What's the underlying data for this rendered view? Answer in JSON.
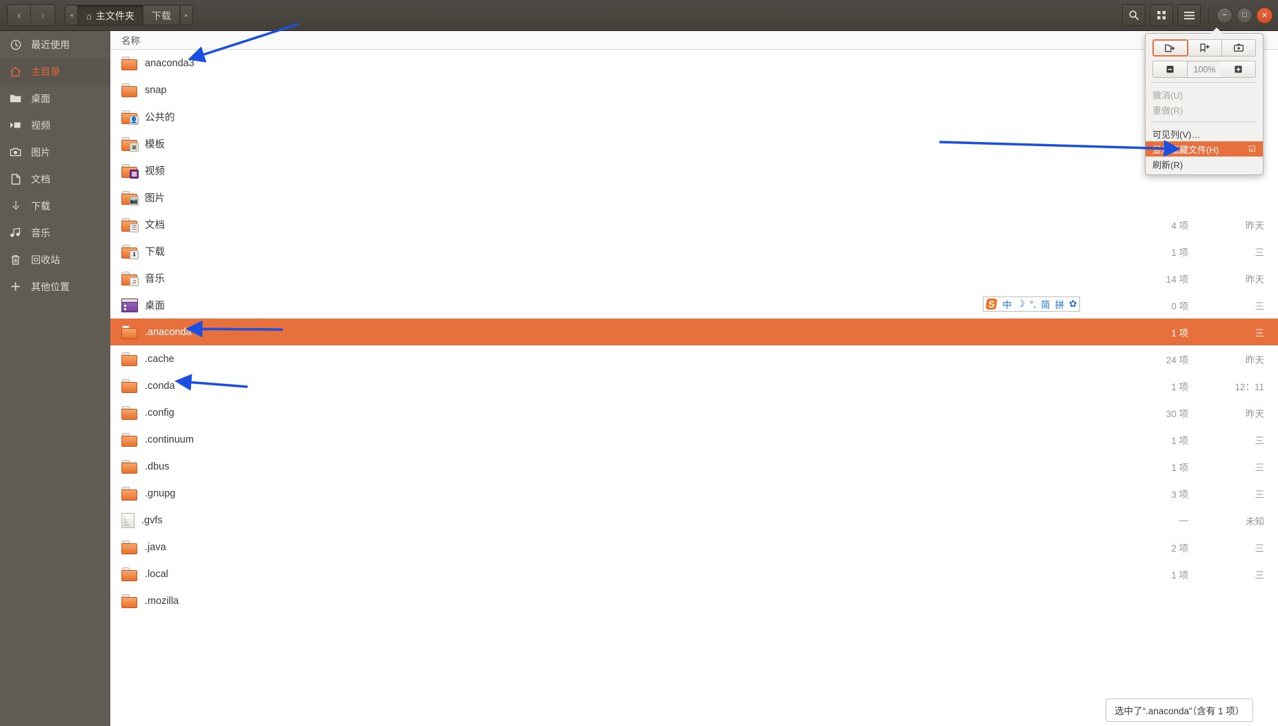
{
  "window": {
    "title": "主文件夹",
    "nav": {
      "back": "‹",
      "forward": "›"
    },
    "pathbar": {
      "left_chevron": "◂",
      "right_chevron": "▸",
      "crumbs": [
        {
          "label": "主文件夹",
          "icon": "home-icon",
          "active": true
        },
        {
          "label": "下载",
          "icon": "",
          "active": false
        }
      ]
    },
    "controls": {
      "search": "search-icon",
      "viewgrid": "grid-view-icon",
      "menu": "hamburger-menu-icon",
      "minimize": "−",
      "maximize": "□",
      "close": "✕"
    }
  },
  "sidebar": {
    "items": [
      {
        "label": "最近使用",
        "icon": "clock-icon",
        "active": false
      },
      {
        "label": "主目录",
        "icon": "home-icon",
        "active": true
      },
      {
        "label": "桌面",
        "icon": "folder-icon",
        "active": false
      },
      {
        "label": "视频",
        "icon": "video-icon",
        "active": false
      },
      {
        "label": "图片",
        "icon": "camera-icon",
        "active": false
      },
      {
        "label": "文档",
        "icon": "document-icon",
        "active": false
      },
      {
        "label": "下载",
        "icon": "download-icon",
        "active": false
      },
      {
        "label": "音乐",
        "icon": "music-icon",
        "active": false
      },
      {
        "label": "回收站",
        "icon": "trash-icon",
        "active": false
      },
      {
        "label": "其他位置",
        "icon": "plus-icon",
        "active": false
      }
    ]
  },
  "filelist": {
    "column_header_name": "名称",
    "rows": [
      {
        "name": "anaconda3",
        "icon": "folder-plain",
        "count": "",
        "date": "",
        "selected": false
      },
      {
        "name": "snap",
        "icon": "folder-plain",
        "count": "",
        "date": "",
        "selected": false
      },
      {
        "name": "公共的",
        "icon": "folder-public",
        "count": "",
        "date": "",
        "selected": false
      },
      {
        "name": "模板",
        "icon": "folder-template",
        "count": "",
        "date": "",
        "selected": false
      },
      {
        "name": "视频",
        "icon": "folder-video",
        "count": "",
        "date": "",
        "selected": false
      },
      {
        "name": "图片",
        "icon": "folder-pictures",
        "count": "",
        "date": "",
        "selected": false
      },
      {
        "name": "文档",
        "icon": "folder-documents",
        "count": "4 项",
        "date": "昨天",
        "selected": false
      },
      {
        "name": "下载",
        "icon": "folder-download",
        "count": "1 项",
        "date": "三",
        "selected": false
      },
      {
        "name": "音乐",
        "icon": "folder-music",
        "count": "14 项",
        "date": "昨天",
        "selected": false
      },
      {
        "name": "桌面",
        "icon": "folder-desktop",
        "count": "0 项",
        "date": "三",
        "selected": false
      },
      {
        "name": ".anaconda",
        "icon": "folder-plain",
        "count": "1 项",
        "date": "三",
        "selected": true
      },
      {
        "name": ".cache",
        "icon": "folder-plain",
        "count": "24 项",
        "date": "昨天",
        "selected": false
      },
      {
        "name": ".conda",
        "icon": "folder-plain",
        "count": "1 项",
        "date": "12：11",
        "selected": false
      },
      {
        "name": ".config",
        "icon": "folder-plain",
        "count": "30 项",
        "date": "昨天",
        "selected": false
      },
      {
        "name": ".continuum",
        "icon": "folder-plain",
        "count": "1 项",
        "date": "三",
        "selected": false
      },
      {
        "name": ".dbus",
        "icon": "folder-plain",
        "count": "1 项",
        "date": "三",
        "selected": false
      },
      {
        "name": ".gnupg",
        "icon": "folder-plain",
        "count": "3 项",
        "date": "三",
        "selected": false
      },
      {
        "name": ".gvfs",
        "icon": "text-file",
        "count": "—",
        "date": "未知",
        "selected": false
      },
      {
        "name": ".java",
        "icon": "folder-plain",
        "count": "2 项",
        "date": "三",
        "selected": false
      },
      {
        "name": ".local",
        "icon": "folder-plain",
        "count": "1 项",
        "date": "三",
        "selected": false
      },
      {
        "name": ".mozilla",
        "icon": "folder-plain",
        "count": "",
        "date": "",
        "selected": false
      }
    ]
  },
  "menu": {
    "toolbar_buttons": [
      {
        "icon": "new-folder-icon",
        "glyph": "🗀",
        "selected": true
      },
      {
        "icon": "add-bookmark-icon",
        "glyph": "🔖",
        "selected": false
      },
      {
        "icon": "new-window-icon",
        "glyph": "🗗",
        "selected": false
      }
    ],
    "zoom_out": "▬",
    "zoom_value": "100%",
    "zoom_in": "✛",
    "items": [
      {
        "label": "撤消(U)",
        "disabled": true,
        "highlight": false,
        "check": ""
      },
      {
        "label": "重做(R)",
        "disabled": true,
        "highlight": false,
        "check": ""
      },
      {
        "label": "可见列(V)…",
        "disabled": false,
        "highlight": false,
        "check": ""
      },
      {
        "label": "显示隐藏文件(H)",
        "disabled": false,
        "highlight": true,
        "check": "☑"
      },
      {
        "label": "刷新(R)",
        "disabled": false,
        "highlight": false,
        "check": ""
      }
    ]
  },
  "ime": {
    "logo": "S",
    "items": [
      "中",
      "☽",
      "°,",
      "简",
      "拼",
      "✿"
    ]
  },
  "status_tooltip": {
    "text": "选中了“.anaconda”（含有 1 项）"
  },
  "colors": {
    "accent": "#e8703c",
    "header_bg": "#4a4640",
    "sidebar_bg": "#605c54",
    "annotation_arrow": "#1a4fe0"
  }
}
